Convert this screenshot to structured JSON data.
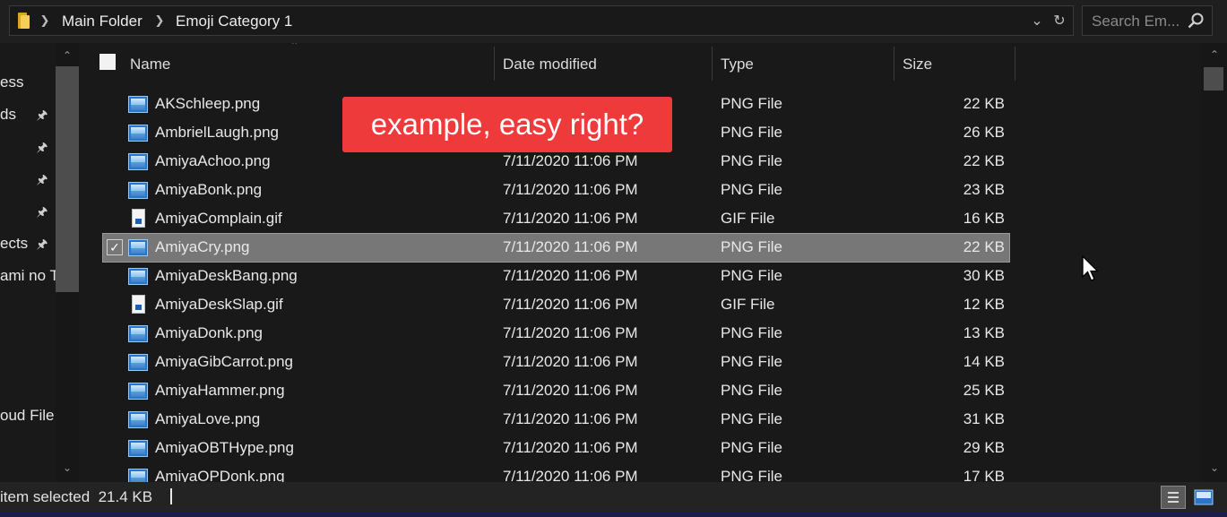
{
  "address_bar": {
    "crumbs": [
      "Main Folder",
      "Emoji Category 1"
    ],
    "icons": [
      "folder-icon",
      "chevron-right-icon",
      "chevron-down-icon",
      "refresh-icon"
    ]
  },
  "search": {
    "placeholder": "Search Em...",
    "icon": "search-icon"
  },
  "nav_pane": {
    "items": [
      {
        "label": "ess",
        "pinned": false
      },
      {
        "label": "ds",
        "pinned": true
      },
      {
        "label": "",
        "pinned": true
      },
      {
        "label": "",
        "pinned": true
      },
      {
        "label": "",
        "pinned": true
      },
      {
        "label": "ects",
        "pinned": true
      },
      {
        "label": "ami no T",
        "pinned": false
      },
      {
        "label": "oud File",
        "pinned": false
      }
    ]
  },
  "columns": {
    "name": "Name",
    "date": "Date modified",
    "type": "Type",
    "size": "Size"
  },
  "files": [
    {
      "name": "AKSchleep.png",
      "date": "",
      "type": "PNG File",
      "size": "22 KB",
      "icon": "image-file-icon"
    },
    {
      "name": "AmbrielLaugh.png",
      "date": "",
      "type": "PNG File",
      "size": "26 KB",
      "icon": "image-file-icon"
    },
    {
      "name": "AmiyaAchoo.png",
      "date": "7/11/2020 11:06 PM",
      "type": "PNG File",
      "size": "22 KB",
      "icon": "image-file-icon"
    },
    {
      "name": "AmiyaBonk.png",
      "date": "7/11/2020 11:06 PM",
      "type": "PNG File",
      "size": "23 KB",
      "icon": "image-file-icon"
    },
    {
      "name": "AmiyaComplain.gif",
      "date": "7/11/2020 11:06 PM",
      "type": "GIF File",
      "size": "16 KB",
      "icon": "gif-file-icon"
    },
    {
      "name": "AmiyaCry.png",
      "date": "7/11/2020 11:06 PM",
      "type": "PNG File",
      "size": "22 KB",
      "icon": "image-file-icon",
      "selected": true
    },
    {
      "name": "AmiyaDeskBang.png",
      "date": "7/11/2020 11:06 PM",
      "type": "PNG File",
      "size": "30 KB",
      "icon": "image-file-icon"
    },
    {
      "name": "AmiyaDeskSlap.gif",
      "date": "7/11/2020 11:06 PM",
      "type": "GIF File",
      "size": "12 KB",
      "icon": "gif-file-icon"
    },
    {
      "name": "AmiyaDonk.png",
      "date": "7/11/2020 11:06 PM",
      "type": "PNG File",
      "size": "13 KB",
      "icon": "image-file-icon"
    },
    {
      "name": "AmiyaGibCarrot.png",
      "date": "7/11/2020 11:06 PM",
      "type": "PNG File",
      "size": "14 KB",
      "icon": "image-file-icon"
    },
    {
      "name": "AmiyaHammer.png",
      "date": "7/11/2020 11:06 PM",
      "type": "PNG File",
      "size": "25 KB",
      "icon": "image-file-icon"
    },
    {
      "name": "AmiyaLove.png",
      "date": "7/11/2020 11:06 PM",
      "type": "PNG File",
      "size": "31 KB",
      "icon": "image-file-icon"
    },
    {
      "name": "AmiyaOBTHype.png",
      "date": "7/11/2020 11:06 PM",
      "type": "PNG File",
      "size": "29 KB",
      "icon": "image-file-icon"
    },
    {
      "name": "AmiyaOPDonk.png",
      "date": "7/11/2020 11:06 PM",
      "type": "PNG File",
      "size": "17 KB",
      "icon": "image-file-icon"
    }
  ],
  "annotation": {
    "text": "example, easy right?",
    "color": "#ee3a3a"
  },
  "status_bar": {
    "text": "item selected  21.4 KB",
    "view_icons": [
      "details-view-icon",
      "large-icons-view-icon"
    ]
  },
  "theme": {
    "background": "#191919",
    "selected_row": "#777777",
    "text": "#e6e6e6"
  }
}
